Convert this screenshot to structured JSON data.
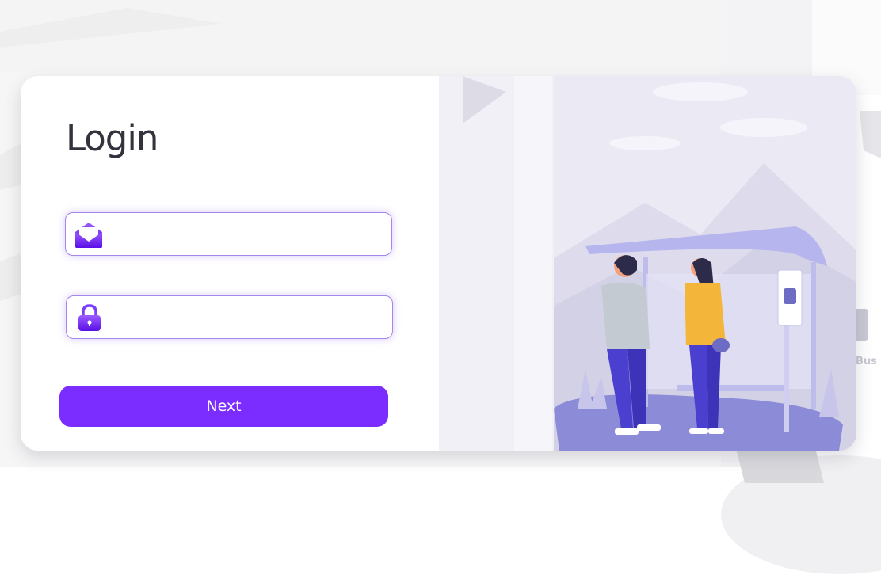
{
  "login": {
    "title": "Login",
    "email_value": "",
    "password_value": "",
    "next_label": "Next"
  },
  "colors": {
    "accent": "#7b2cff",
    "field_border": "#a486ec",
    "illustration_bg": "#ebeaf2"
  },
  "icons": {
    "email": "envelope-icon",
    "password": "lock-icon"
  },
  "background": {
    "bus_sign_text": "Bus"
  }
}
